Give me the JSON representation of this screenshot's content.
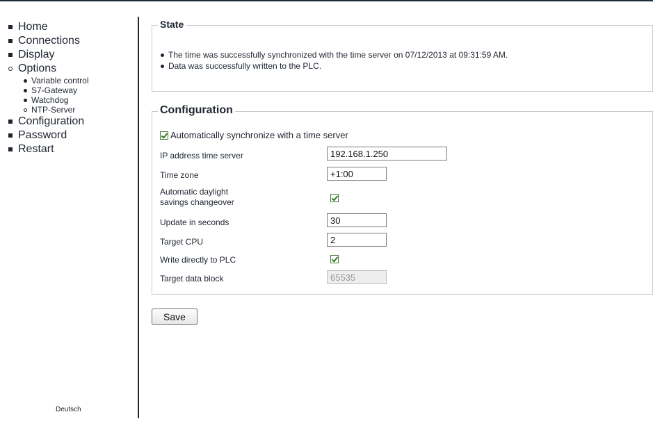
{
  "nav": {
    "items": [
      {
        "label": "Home"
      },
      {
        "label": "Connections"
      },
      {
        "label": "Display"
      },
      {
        "label": "Options"
      },
      {
        "label": "Configuration"
      },
      {
        "label": "Password"
      },
      {
        "label": "Restart"
      }
    ],
    "options_sub": [
      {
        "label": "Variable control"
      },
      {
        "label": "S7-Gateway"
      },
      {
        "label": "Watchdog"
      },
      {
        "label": "NTP-Server"
      }
    ],
    "language": "Deutsch"
  },
  "state": {
    "legend": "State",
    "messages": [
      "The time was successfully synchronized with the time server on 07/12/2013 at 09:31:59 AM.",
      "Data was successfully written to the PLC."
    ]
  },
  "config": {
    "legend": "Configuration",
    "auto_sync_label": "Automatically synchronize with a time server",
    "auto_sync_checked": true,
    "ip_label": "IP address time server",
    "ip_value": "192.168.1.250",
    "tz_label": "Time zone",
    "tz_value": "+1:00",
    "dst_label_line1": "Automatic daylight",
    "dst_label_line2": "savings changeover",
    "dst_checked": true,
    "update_label": "Update in seconds",
    "update_value": "30",
    "cpu_label": "Target CPU",
    "cpu_value": "2",
    "write_label": "Write directly to PLC",
    "write_checked": true,
    "db_label": "Target data block",
    "db_value": "65535"
  },
  "actions": {
    "save_label": "Save"
  },
  "colors": {
    "rule": "#1c2a3a",
    "text": "#1e2530",
    "fieldset_border": "#c9c9c9",
    "checkmark": "#2e7d1e"
  }
}
